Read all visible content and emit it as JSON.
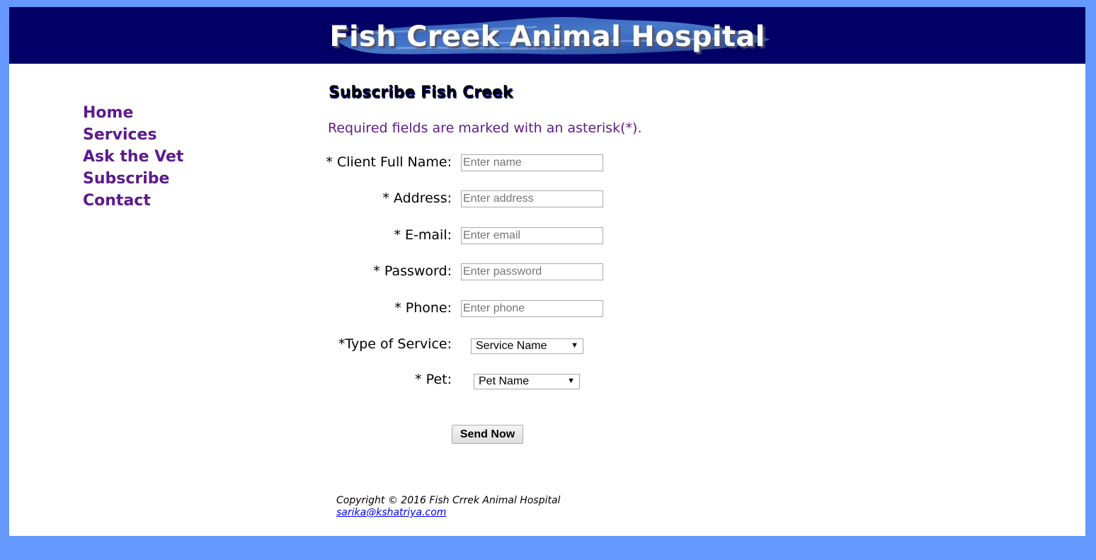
{
  "header": {
    "title": "Fish Creek Animal Hospital"
  },
  "nav": {
    "items": [
      {
        "label": "Home"
      },
      {
        "label": "Services"
      },
      {
        "label": "Ask the Vet"
      },
      {
        "label": "Subscribe"
      },
      {
        "label": "Contact"
      }
    ]
  },
  "main": {
    "title": "Subscribe Fish Creek",
    "required_note": "Required fields are marked with an asterisk(*)."
  },
  "form": {
    "name": {
      "label": "* Client Full Name:",
      "placeholder": "Enter name",
      "value": ""
    },
    "address": {
      "label": "* Address:",
      "placeholder": "Enter address",
      "value": ""
    },
    "email": {
      "label": "* E-mail:",
      "placeholder": "Enter email",
      "value": ""
    },
    "password": {
      "label": "* Password:",
      "placeholder": "Enter password",
      "value": ""
    },
    "phone": {
      "label": "* Phone:",
      "placeholder": "Enter phone",
      "value": ""
    },
    "service": {
      "label": "*Type of Service:",
      "selected": "Service Name"
    },
    "pet": {
      "label": "* Pet:",
      "selected": "Pet Name"
    },
    "submit_label": "Send Now"
  },
  "footer": {
    "copyright": "Copyright © 2016 Fish Crrek Animal Hospital",
    "email": "sarika@kshatriya.com"
  },
  "colors": {
    "page_background": "#6699ff",
    "header_background": "#000066",
    "nav_link": "#5c1a8c",
    "link": "#0000ee"
  }
}
